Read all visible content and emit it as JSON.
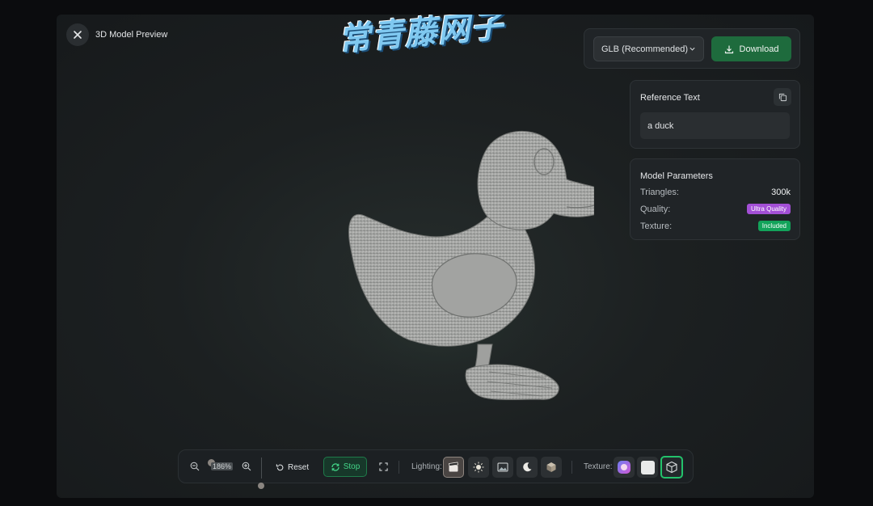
{
  "header": {
    "title": "3D Model Preview",
    "watermark": "常青藤网子"
  },
  "download": {
    "format": "GLB (Recommended)",
    "button_label": "Download"
  },
  "reference": {
    "title": "Reference Text",
    "text": "a duck"
  },
  "parameters": {
    "title": "Model Parameters",
    "rows": [
      {
        "label": "Triangles:",
        "value": "300k"
      },
      {
        "label": "Quality:",
        "value": "Ultra Quality"
      },
      {
        "label": "Texture:",
        "value": "Included"
      }
    ]
  },
  "toolbar": {
    "zoom": "186%",
    "reset_label": "Reset",
    "stop_label": "Stop",
    "lighting_label": "Lighting:",
    "texture_label": "Texture:",
    "lighting_modes": [
      "clapperboard-icon",
      "sun-icon",
      "image-icon",
      "moon-icon",
      "cube-icon"
    ],
    "texture_modes": [
      "color-texture-icon",
      "white-material-icon",
      "wireframe-cube-icon"
    ]
  },
  "colors": {
    "accent_green": "#1e6b3d",
    "quality_badge": "#a34fd6",
    "texture_badge": "#12a35a"
  }
}
